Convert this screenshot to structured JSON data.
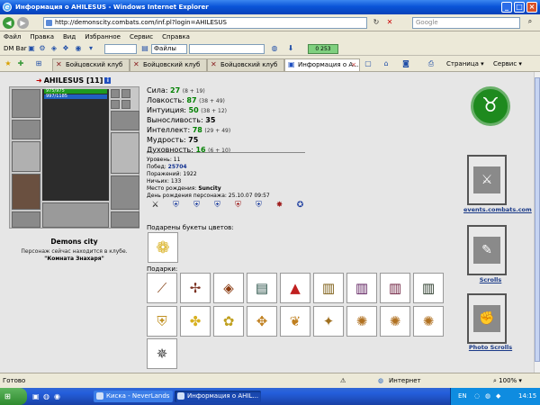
{
  "window": {
    "title": "Информация о AHILESUS - Windows Internet Explorer"
  },
  "address": {
    "url": "http://demonscity.combats.com/inf.pl?login=AHILESUS",
    "search_placeholder": "Google"
  },
  "menu": [
    "Файл",
    "Правка",
    "Вид",
    "Избранное",
    "Сервис",
    "Справка"
  ],
  "toolbar": {
    "dm_bar": "DM Bar",
    "files_label": "Файлы",
    "counter": "0 253"
  },
  "tabs": [
    {
      "label": "Бойцовский клуб",
      "active": false
    },
    {
      "label": "Бойцовский клуб",
      "active": false
    },
    {
      "label": "Бойцовский клуб",
      "active": false
    },
    {
      "label": "Информация о A...",
      "active": true
    }
  ],
  "ie_toolbar": {
    "page": "Страница",
    "service": "Сервис"
  },
  "character": {
    "name": "AHILESUS",
    "level": "[11]",
    "hp": "975/975",
    "mp": "997/1185",
    "city": "Demons city",
    "location_text": "Персонаж сейчас находится в клубе.",
    "location_room": "\"Комната Знахаря\""
  },
  "stats": [
    {
      "label": "Сила:",
      "value": "27",
      "bonus": "(8 + 19)"
    },
    {
      "label": "Ловкость:",
      "value": "87",
      "bonus": "(38 + 49)"
    },
    {
      "label": "Интуиция:",
      "value": "50",
      "bonus": "(38 + 12)"
    },
    {
      "label": "Выносливость:",
      "value": "35",
      "bonus": ""
    },
    {
      "label": "Интеллект:",
      "value": "78",
      "bonus": "(29 + 49)"
    },
    {
      "label": "Мудрость:",
      "value": "75",
      "bonus": ""
    },
    {
      "label": "Духовность:",
      "value": "16",
      "bonus": "(6 + 10)"
    }
  ],
  "info": {
    "level": "Уровень: 11",
    "wins_label": "Побед:",
    "wins": "25704",
    "losses": "Поражений: 1922",
    "draws": "Ничьих: 133",
    "birth_place_label": "Место рождения:",
    "birth_place": "Suncity",
    "birthday": "День рождения персонажа: 25.10.07 09:57"
  },
  "sections": {
    "bouquets": "Подарены букеты цветов:",
    "gifts": "Подарки:"
  },
  "right_links": {
    "events": "events.combats.com",
    "scrolls": "Scrolls",
    "photo": "Photo Scrolls"
  },
  "status": {
    "done": "Готово",
    "zone": "Интернет",
    "zoom": "100%"
  },
  "taskbar": {
    "tasks": [
      {
        "label": "Киска - NeverLands",
        "active": false
      },
      {
        "label": "Информация о AHIL...",
        "active": true
      }
    ],
    "lang": "EN",
    "time": "14:15"
  }
}
